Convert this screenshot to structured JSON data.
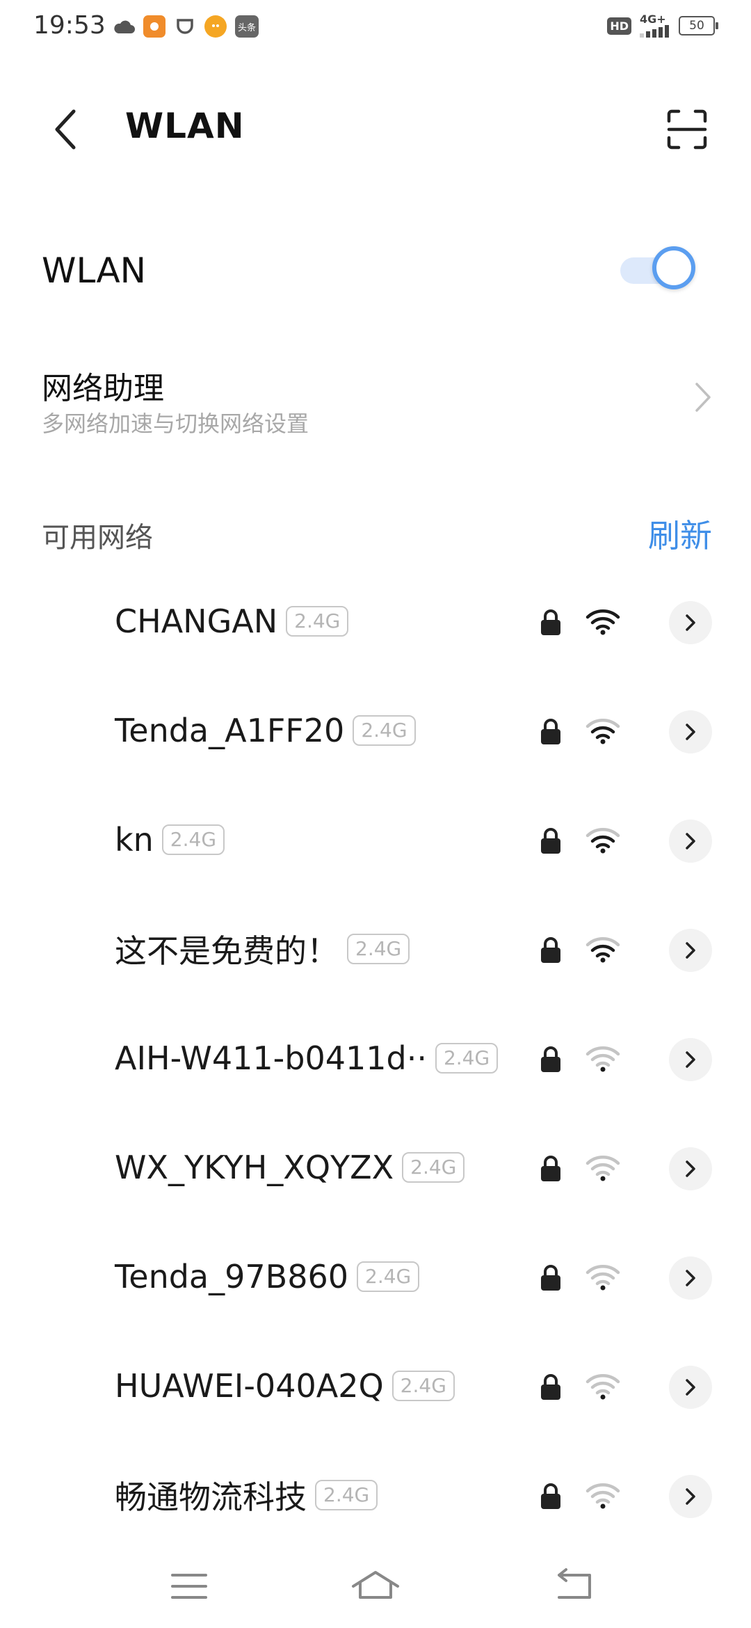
{
  "status_bar": {
    "time": "19:53",
    "left_icons": [
      {
        "name": "cloud-icon",
        "color": "#555555"
      },
      {
        "name": "app-orange-icon",
        "color": "#f08c2b"
      },
      {
        "name": "cup-icon",
        "color": "#555555"
      },
      {
        "name": "app-yellow-icon",
        "color": "#f5a623"
      },
      {
        "name": "toutiao-icon",
        "color": "#666666",
        "label": "头条"
      }
    ],
    "hd_label": "HD",
    "network_label": "4G+",
    "battery": "50"
  },
  "header": {
    "title": "WLAN"
  },
  "wlan_toggle": {
    "label": "WLAN",
    "on": true
  },
  "network_assistant": {
    "title": "网络助理",
    "subtitle": "多网络加速与切换网络设置"
  },
  "available": {
    "title": "可用网络",
    "refresh_label": "刷新"
  },
  "networks": [
    {
      "name": "CHANGAN",
      "band": "2.4G",
      "signal": 4
    },
    {
      "name": "Tenda_A1FF20",
      "band": "2.4G",
      "signal": 3
    },
    {
      "name": "kn",
      "band": "2.4G",
      "signal": 3
    },
    {
      "name": "这不是免费的！",
      "band": "2.4G",
      "signal": 3
    },
    {
      "name": "AIH-W411-b0411d··",
      "band": "2.4G",
      "signal": 1
    },
    {
      "name": "WX_YKYH_XQYZX",
      "band": "2.4G",
      "signal": 1
    },
    {
      "name": "Tenda_97B860",
      "band": "2.4G",
      "signal": 1
    },
    {
      "name": "HUAWEI-040A2Q",
      "band": "2.4G",
      "signal": 1
    },
    {
      "name": "畅通物流科技",
      "band": "2.4G",
      "signal": 1
    }
  ],
  "colors": {
    "accent": "#3f8ee8",
    "toggle_knob": "#5b9ef0",
    "toggle_track": "#dde9fb",
    "wifi_strong": "#1a1a1a",
    "wifi_weak": "#c4c4c4"
  }
}
